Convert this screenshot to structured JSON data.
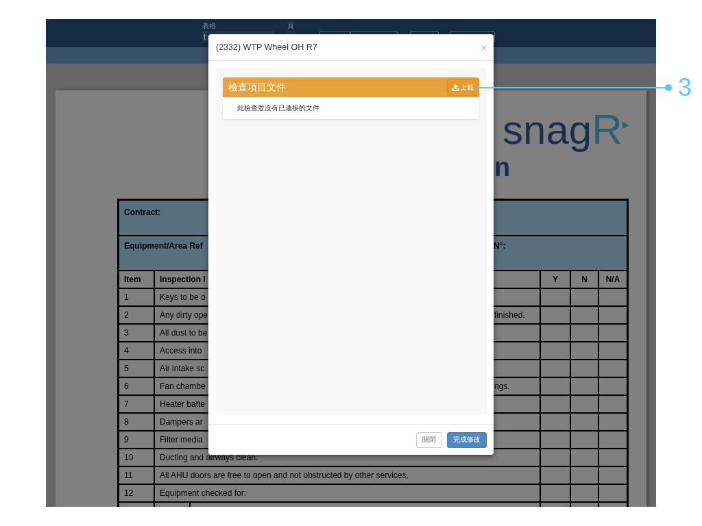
{
  "toolbar": {
    "form_label": "表格",
    "form_value": "t",
    "page_label": "頁"
  },
  "document": {
    "logo": {
      "main": "snag",
      "accent": "R"
    },
    "heading": "n",
    "table": {
      "contract_label": "Contract:",
      "equipment_label": "Equipment/Area Ref",
      "equipment_label_right": "N°:",
      "columns": [
        {
          "label": "Item"
        },
        {
          "label": "Inspection I"
        },
        {
          "label": "Y"
        },
        {
          "label": "N"
        },
        {
          "label": "N/A"
        }
      ],
      "rows": [
        {
          "item": "1",
          "text": "Keys to be o"
        },
        {
          "item": "2",
          "text": "Any dirty ope",
          "text_right": "finished."
        },
        {
          "item": "3",
          "text": "All dust to be"
        },
        {
          "item": "4",
          "text": "Access into"
        },
        {
          "item": "5",
          "text": "Air intake sc"
        },
        {
          "item": "6",
          "text": "Fan chambe",
          "text_right": "ngs."
        },
        {
          "item": "7",
          "text": "Heater batte"
        },
        {
          "item": "8",
          "text": "Dampers ar"
        },
        {
          "item": "9",
          "text": "Filter media"
        },
        {
          "item": "10",
          "text": "Ducting and airways clean."
        },
        {
          "item": "11",
          "text": "All AHU doors are free to open and not obstructed by other services."
        },
        {
          "item": "12",
          "text": "Equipment checked for:"
        }
      ]
    }
  },
  "modal": {
    "title": "(2332) WTP Wheel OH R7",
    "close": "×",
    "panel": {
      "title": "檢查項目文件",
      "upload_label": "上載",
      "empty_message": "此檢查並沒有已連接的文件"
    },
    "buttons": [
      {
        "label": "關閉",
        "kind": "default"
      },
      {
        "label": "完成修改",
        "kind": "primary"
      }
    ]
  },
  "annotation": {
    "number": "3"
  }
}
